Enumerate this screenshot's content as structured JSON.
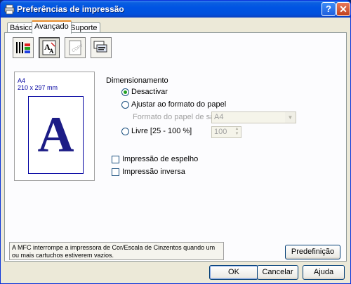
{
  "window": {
    "title": "Preferências de impressão",
    "help_label": "?",
    "close_label": "✕"
  },
  "tabs": [
    {
      "label": "Básico",
      "active": false
    },
    {
      "label": "Avançado",
      "active": true
    },
    {
      "label": "Suporte",
      "active": false
    }
  ],
  "toolbar": {
    "buttons": [
      {
        "icon": "color-quality-icon",
        "pressed": false
      },
      {
        "icon": "scaling-icon",
        "pressed": true
      },
      {
        "icon": "watermark-icon",
        "pressed": false
      },
      {
        "icon": "device-options-icon",
        "pressed": false
      }
    ]
  },
  "preview": {
    "paper": "A4",
    "size": "210 x 297 mm",
    "letter": "A"
  },
  "scaling": {
    "group_label": "Dimensionamento",
    "off_label": "Desactivar",
    "fit_label": "Ajustar ao formato do papel",
    "output_paper_label": "Formato do papel de saída",
    "output_paper_value": "A4",
    "free_label": "Livre [25 - 100 %]",
    "free_value": "100",
    "selected": "off"
  },
  "options": {
    "mirror_label": "Impressão de espelho",
    "mirror_checked": false,
    "reverse_label": "Impressão inversa",
    "reverse_checked": false
  },
  "status_message": "A MFC interrompe a impressora de Cor/Escala de Cinzentos quando um ou mais cartuchos estiverem vazios.",
  "buttons": {
    "default_label": "Predefinição",
    "ok_label": "OK",
    "cancel_label": "Cancelar",
    "help_label": "Ajuda"
  }
}
